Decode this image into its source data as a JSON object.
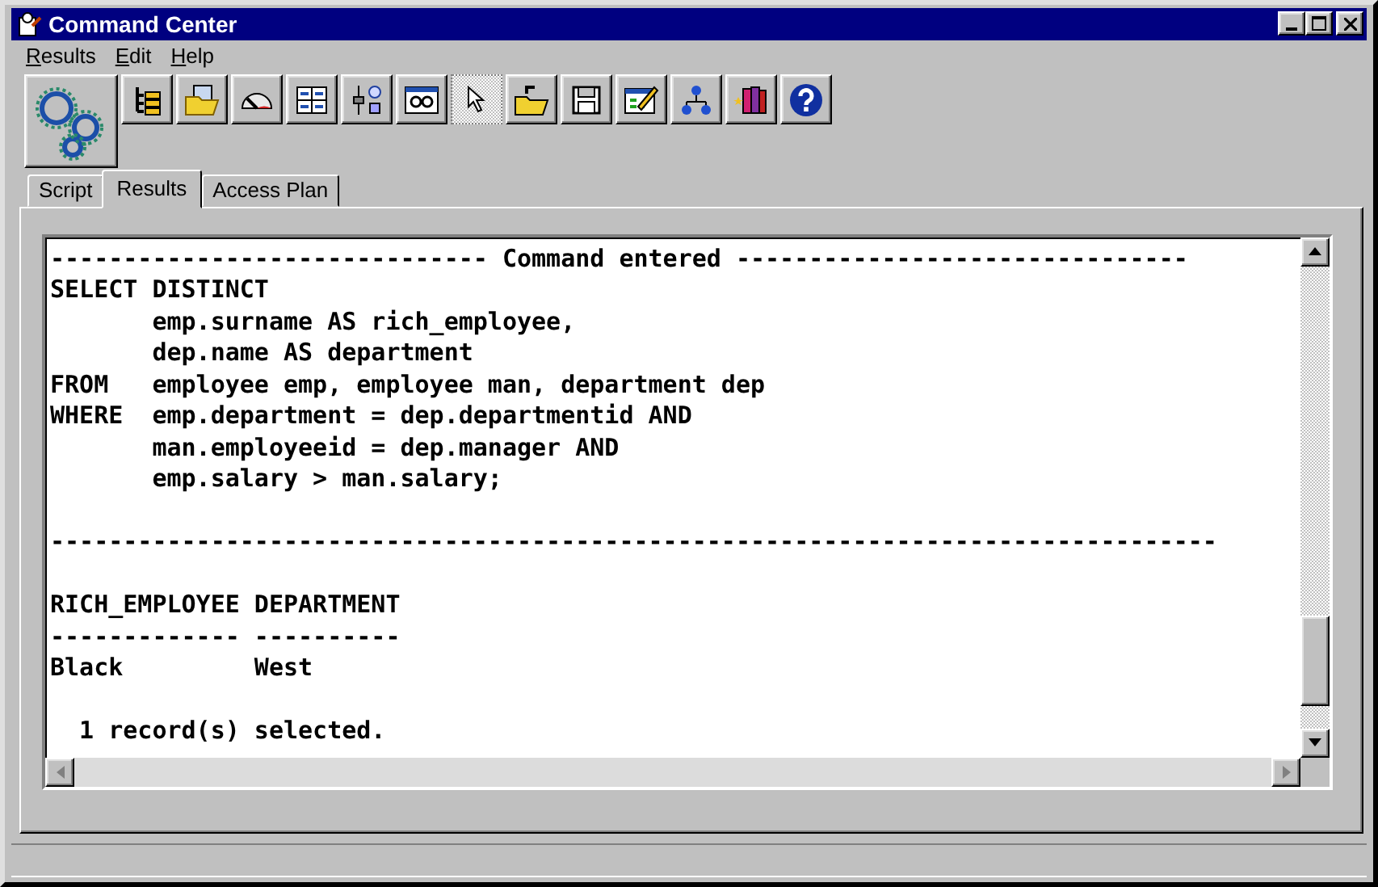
{
  "window": {
    "title": "Command Center"
  },
  "menu": [
    "Results",
    "Edit",
    "Help"
  ],
  "toolbar": [
    {
      "kind": "gears",
      "pressed": false
    },
    {
      "kind": "tree",
      "pressed": false
    },
    {
      "kind": "folder-doc",
      "pressed": false
    },
    {
      "kind": "gauge",
      "pressed": false
    },
    {
      "kind": "form",
      "pressed": false
    },
    {
      "kind": "sliders",
      "pressed": false
    },
    {
      "kind": "glasses",
      "pressed": false
    },
    {
      "kind": "pointer",
      "pressed": true
    },
    {
      "kind": "open-folder",
      "pressed": false
    },
    {
      "kind": "save",
      "pressed": false
    },
    {
      "kind": "edit-grid",
      "pressed": false
    },
    {
      "kind": "hierarchy",
      "pressed": false
    },
    {
      "kind": "books",
      "pressed": false
    },
    {
      "kind": "help",
      "pressed": false
    }
  ],
  "tabs": [
    {
      "label": "Script",
      "selected": false
    },
    {
      "label": "Results",
      "selected": true
    },
    {
      "label": "Access Plan",
      "selected": false
    }
  ],
  "output": {
    "header": "------------------------------ Command entered -------------------------------",
    "statement": [
      "SELECT DISTINCT",
      "       emp.surname AS rich_employee,",
      "       dep.name AS department",
      "FROM   employee emp, employee man, department dep",
      "WHERE  emp.department = dep.departmentid AND",
      "       man.employeeid = dep.manager AND",
      "       emp.salary > man.salary;"
    ],
    "rule": "--------------------------------------------------------------------------------",
    "headings": "RICH_EMPLOYEE DEPARTMENT",
    "underline": "------------- ----------",
    "rows": [
      "Black         West"
    ],
    "summary": "  1 record(s) selected."
  }
}
